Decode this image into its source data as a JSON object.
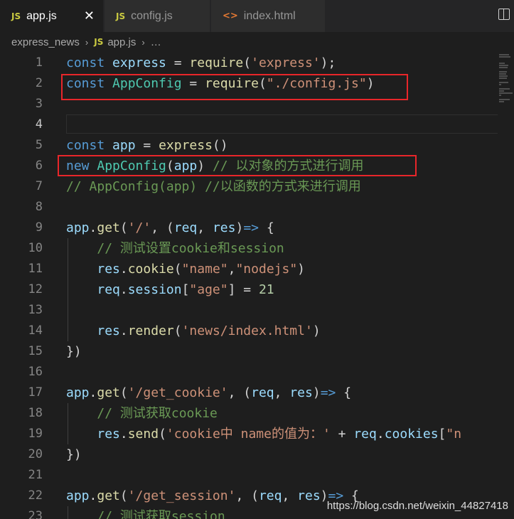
{
  "tabs": [
    {
      "icon": "JS",
      "label": "app.js",
      "active": true,
      "close": "✕"
    },
    {
      "icon": "JS",
      "label": "config.js",
      "active": false
    },
    {
      "icon": "<>",
      "label": "index.html",
      "active": false
    }
  ],
  "breadcrumb": {
    "folder": "express_news",
    "sep": "›",
    "icon": "JS",
    "file": "app.js",
    "more": "…"
  },
  "lines": [
    {
      "n": "1",
      "tokens": [
        [
          "kw",
          "const"
        ],
        [
          "pn",
          " "
        ],
        [
          "var",
          "express"
        ],
        [
          "pn",
          " = "
        ],
        [
          "fn",
          "require"
        ],
        [
          "pn",
          "("
        ],
        [
          "str",
          "'express'"
        ],
        [
          "pn",
          ");"
        ]
      ]
    },
    {
      "n": "2",
      "tokens": [
        [
          "kw",
          "const"
        ],
        [
          "pn",
          " "
        ],
        [
          "cls",
          "AppConfig"
        ],
        [
          "pn",
          " = "
        ],
        [
          "fn",
          "require"
        ],
        [
          "pn",
          "("
        ],
        [
          "str",
          "\"./config.js\""
        ],
        [
          "pn",
          ")"
        ]
      ]
    },
    {
      "n": "3",
      "tokens": []
    },
    {
      "n": "4",
      "tokens": [],
      "current": true
    },
    {
      "n": "5",
      "tokens": [
        [
          "kw",
          "const"
        ],
        [
          "pn",
          " "
        ],
        [
          "var",
          "app"
        ],
        [
          "pn",
          " = "
        ],
        [
          "fn",
          "express"
        ],
        [
          "pn",
          "()"
        ]
      ]
    },
    {
      "n": "6",
      "tokens": [
        [
          "kw",
          "new"
        ],
        [
          "pn",
          " "
        ],
        [
          "cls",
          "AppConfig"
        ],
        [
          "pn",
          "("
        ],
        [
          "var",
          "app"
        ],
        [
          "pn",
          ") "
        ],
        [
          "cm",
          "// 以对象的方式进行调用"
        ]
      ]
    },
    {
      "n": "7",
      "tokens": [
        [
          "cm",
          "// AppConfig(app) //以函数的方式来进行调用"
        ]
      ]
    },
    {
      "n": "8",
      "tokens": []
    },
    {
      "n": "9",
      "tokens": [
        [
          "var",
          "app"
        ],
        [
          "pn",
          "."
        ],
        [
          "fn",
          "get"
        ],
        [
          "pn",
          "("
        ],
        [
          "str",
          "'/'"
        ],
        [
          "pn",
          ", ("
        ],
        [
          "var",
          "req"
        ],
        [
          "pn",
          ", "
        ],
        [
          "var",
          "res"
        ],
        [
          "pn",
          ")"
        ],
        [
          "kw",
          "=>"
        ],
        [
          "pn",
          " {"
        ]
      ]
    },
    {
      "n": "10",
      "tokens": [
        [
          "pn",
          "    "
        ],
        [
          "cm",
          "// 测试设置cookie和session"
        ]
      ]
    },
    {
      "n": "11",
      "tokens": [
        [
          "pn",
          "    "
        ],
        [
          "var",
          "res"
        ],
        [
          "pn",
          "."
        ],
        [
          "fn",
          "cookie"
        ],
        [
          "pn",
          "("
        ],
        [
          "str",
          "\"name\""
        ],
        [
          "pn",
          ","
        ],
        [
          "str",
          "\"nodejs\""
        ],
        [
          "pn",
          ")"
        ]
      ]
    },
    {
      "n": "12",
      "tokens": [
        [
          "pn",
          "    "
        ],
        [
          "var",
          "req"
        ],
        [
          "pn",
          "."
        ],
        [
          "var",
          "session"
        ],
        [
          "pn",
          "["
        ],
        [
          "str",
          "\"age\""
        ],
        [
          "pn",
          "] = "
        ],
        [
          "num",
          "21"
        ]
      ]
    },
    {
      "n": "13",
      "tokens": []
    },
    {
      "n": "14",
      "tokens": [
        [
          "pn",
          "    "
        ],
        [
          "var",
          "res"
        ],
        [
          "pn",
          "."
        ],
        [
          "fn",
          "render"
        ],
        [
          "pn",
          "("
        ],
        [
          "str",
          "'news/index.html'"
        ],
        [
          "pn",
          ")"
        ]
      ]
    },
    {
      "n": "15",
      "tokens": [
        [
          "pn",
          "})"
        ]
      ]
    },
    {
      "n": "16",
      "tokens": []
    },
    {
      "n": "17",
      "tokens": [
        [
          "var",
          "app"
        ],
        [
          "pn",
          "."
        ],
        [
          "fn",
          "get"
        ],
        [
          "pn",
          "("
        ],
        [
          "str",
          "'/get_cookie'"
        ],
        [
          "pn",
          ", ("
        ],
        [
          "var",
          "req"
        ],
        [
          "pn",
          ", "
        ],
        [
          "var",
          "res"
        ],
        [
          "pn",
          ")"
        ],
        [
          "kw",
          "=>"
        ],
        [
          "pn",
          " {"
        ]
      ]
    },
    {
      "n": "18",
      "tokens": [
        [
          "pn",
          "    "
        ],
        [
          "cm",
          "// 测试获取cookie"
        ]
      ]
    },
    {
      "n": "19",
      "tokens": [
        [
          "pn",
          "    "
        ],
        [
          "var",
          "res"
        ],
        [
          "pn",
          "."
        ],
        [
          "fn",
          "send"
        ],
        [
          "pn",
          "("
        ],
        [
          "str",
          "'cookie中 name的值为：'"
        ],
        [
          "pn",
          " + "
        ],
        [
          "var",
          "req"
        ],
        [
          "pn",
          "."
        ],
        [
          "var",
          "cookies"
        ],
        [
          "pn",
          "["
        ],
        [
          "str",
          "\"n"
        ]
      ]
    },
    {
      "n": "20",
      "tokens": [
        [
          "pn",
          "})"
        ]
      ]
    },
    {
      "n": "21",
      "tokens": []
    },
    {
      "n": "22",
      "tokens": [
        [
          "var",
          "app"
        ],
        [
          "pn",
          "."
        ],
        [
          "fn",
          "get"
        ],
        [
          "pn",
          "("
        ],
        [
          "str",
          "'/get_session'"
        ],
        [
          "pn",
          ", ("
        ],
        [
          "var",
          "req"
        ],
        [
          "pn",
          ", "
        ],
        [
          "var",
          "res"
        ],
        [
          "pn",
          ")"
        ],
        [
          "kw",
          "=>"
        ],
        [
          "pn",
          " {"
        ]
      ]
    },
    {
      "n": "23",
      "tokens": [
        [
          "pn",
          "    "
        ],
        [
          "cm",
          "// 测试获取session"
        ]
      ]
    }
  ],
  "watermark": "https://blog.csdn.net/weixin_44827418",
  "colors": {
    "highlight_box": "#e8262a",
    "editor_bg": "#1e1e1e"
  }
}
